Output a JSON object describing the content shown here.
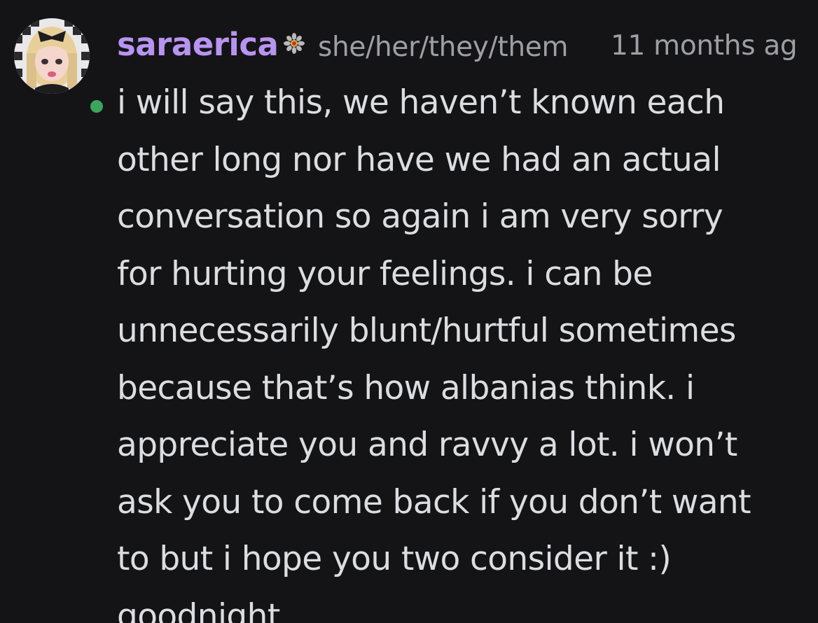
{
  "message": {
    "username": "saraerica",
    "badge_icon": "flower-icon",
    "pronouns": "she/her/they/them",
    "timestamp": "11 months ag",
    "status": "online",
    "status_color": "#3ba55d",
    "username_color": "#b894f0",
    "lines": [
      "i will say this, we haven’t known each",
      "other long nor have we had an actual",
      "conversation so again i am very sorry",
      "for hurting your feelings. i can be",
      "unnecessarily blunt/hurtful sometimes",
      "because that’s how albanias think. i",
      "appreciate you and ravvy a lot. i won’t",
      "ask you to come back if you don’t want",
      "to but i hope you two consider it :)",
      "goodnight"
    ]
  }
}
